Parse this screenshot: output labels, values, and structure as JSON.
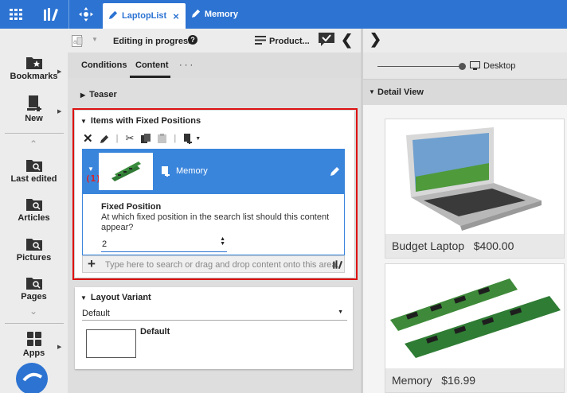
{
  "topbar": {
    "tabs": [
      {
        "label": "LaptopList",
        "close": "×"
      },
      {
        "label": "Memory"
      }
    ]
  },
  "leftnav": {
    "items": [
      {
        "label": "Bookmarks"
      },
      {
        "label": "New"
      },
      {
        "label": "Last edited"
      },
      {
        "label": "Articles"
      },
      {
        "label": "Pictures"
      },
      {
        "label": "Pages"
      },
      {
        "label": "Apps"
      }
    ]
  },
  "editor": {
    "status": "Editing in progress",
    "help": "?",
    "product_label": "Product...",
    "tabs": {
      "conditions": "Conditions",
      "content": "Content",
      "more": "· · ·"
    },
    "teaser": "Teaser",
    "fixed": {
      "title": "Items with Fixed Positions",
      "marker": "(1)",
      "item_name": "Memory",
      "position_label": "Fixed Position",
      "position_question": "At which fixed position in the search list should this content appear?",
      "position_value": "2",
      "search_placeholder": "Type here to search or drag and drop content onto this area."
    },
    "layout": {
      "title": "Layout Variant",
      "selected": "Default",
      "thumb_label": "Default"
    }
  },
  "preview": {
    "device": "Desktop",
    "detail_view": "Detail View",
    "products": [
      {
        "name": "Budget Laptop",
        "price": "$400.00"
      },
      {
        "name": "Memory",
        "price": "$16.99"
      }
    ]
  },
  "colors": {
    "accent": "#2c73d2",
    "highlight": "#d11111"
  }
}
